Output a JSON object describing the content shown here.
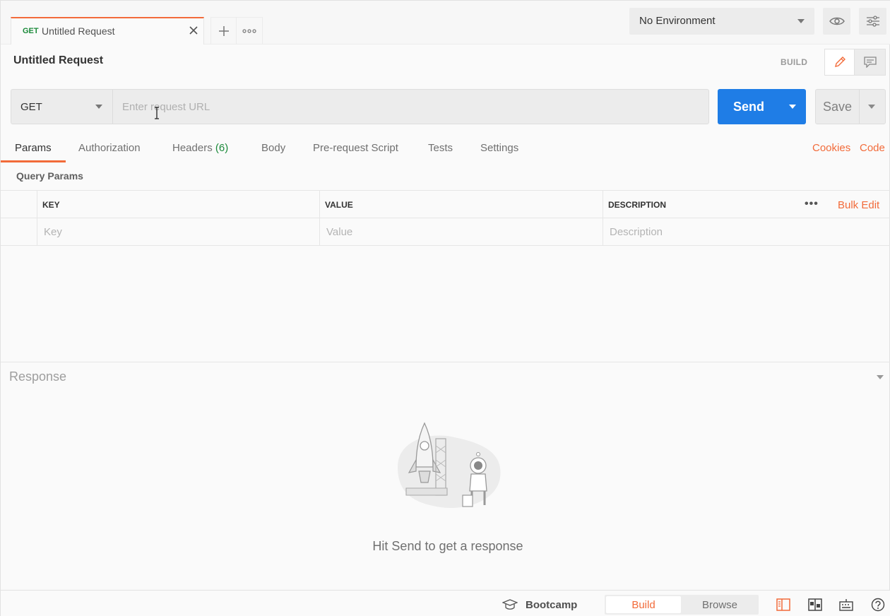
{
  "tab": {
    "method": "GET",
    "title": "Untitled Request"
  },
  "environment": {
    "selected": "No Environment"
  },
  "request": {
    "name": "Untitled Request",
    "mode_label": "BUILD",
    "method": "GET",
    "url_placeholder": "Enter request URL",
    "send_label": "Send",
    "save_label": "Save"
  },
  "request_tabs": {
    "params": "Params",
    "authorization": "Authorization",
    "headers": "Headers",
    "headers_count": "(6)",
    "body": "Body",
    "pre_request": "Pre-request Script",
    "tests": "Tests",
    "settings": "Settings",
    "cookies": "Cookies",
    "code": "Code"
  },
  "query_params": {
    "title": "Query Params",
    "columns": [
      "KEY",
      "VALUE",
      "DESCRIPTION"
    ],
    "placeholders": [
      "Key",
      "Value",
      "Description"
    ],
    "more": "•••",
    "bulk_edit": "Bulk Edit"
  },
  "response": {
    "title": "Response",
    "hint": "Hit Send to get a response"
  },
  "statusbar": {
    "bootcamp": "Bootcamp",
    "build": "Build",
    "browse": "Browse"
  },
  "colors": {
    "accent": "#f26b3a",
    "primary": "#1f7de6",
    "get_method": "#1b8a3a"
  },
  "icons": [
    "close-icon",
    "plus-icon",
    "more-icon",
    "eye-icon",
    "sliders-icon",
    "pencil-icon",
    "comment-icon",
    "rocket-illustration",
    "graduation-cap-icon",
    "two-pane-icon",
    "layout-icon",
    "keyboard-icon",
    "help-icon"
  ]
}
